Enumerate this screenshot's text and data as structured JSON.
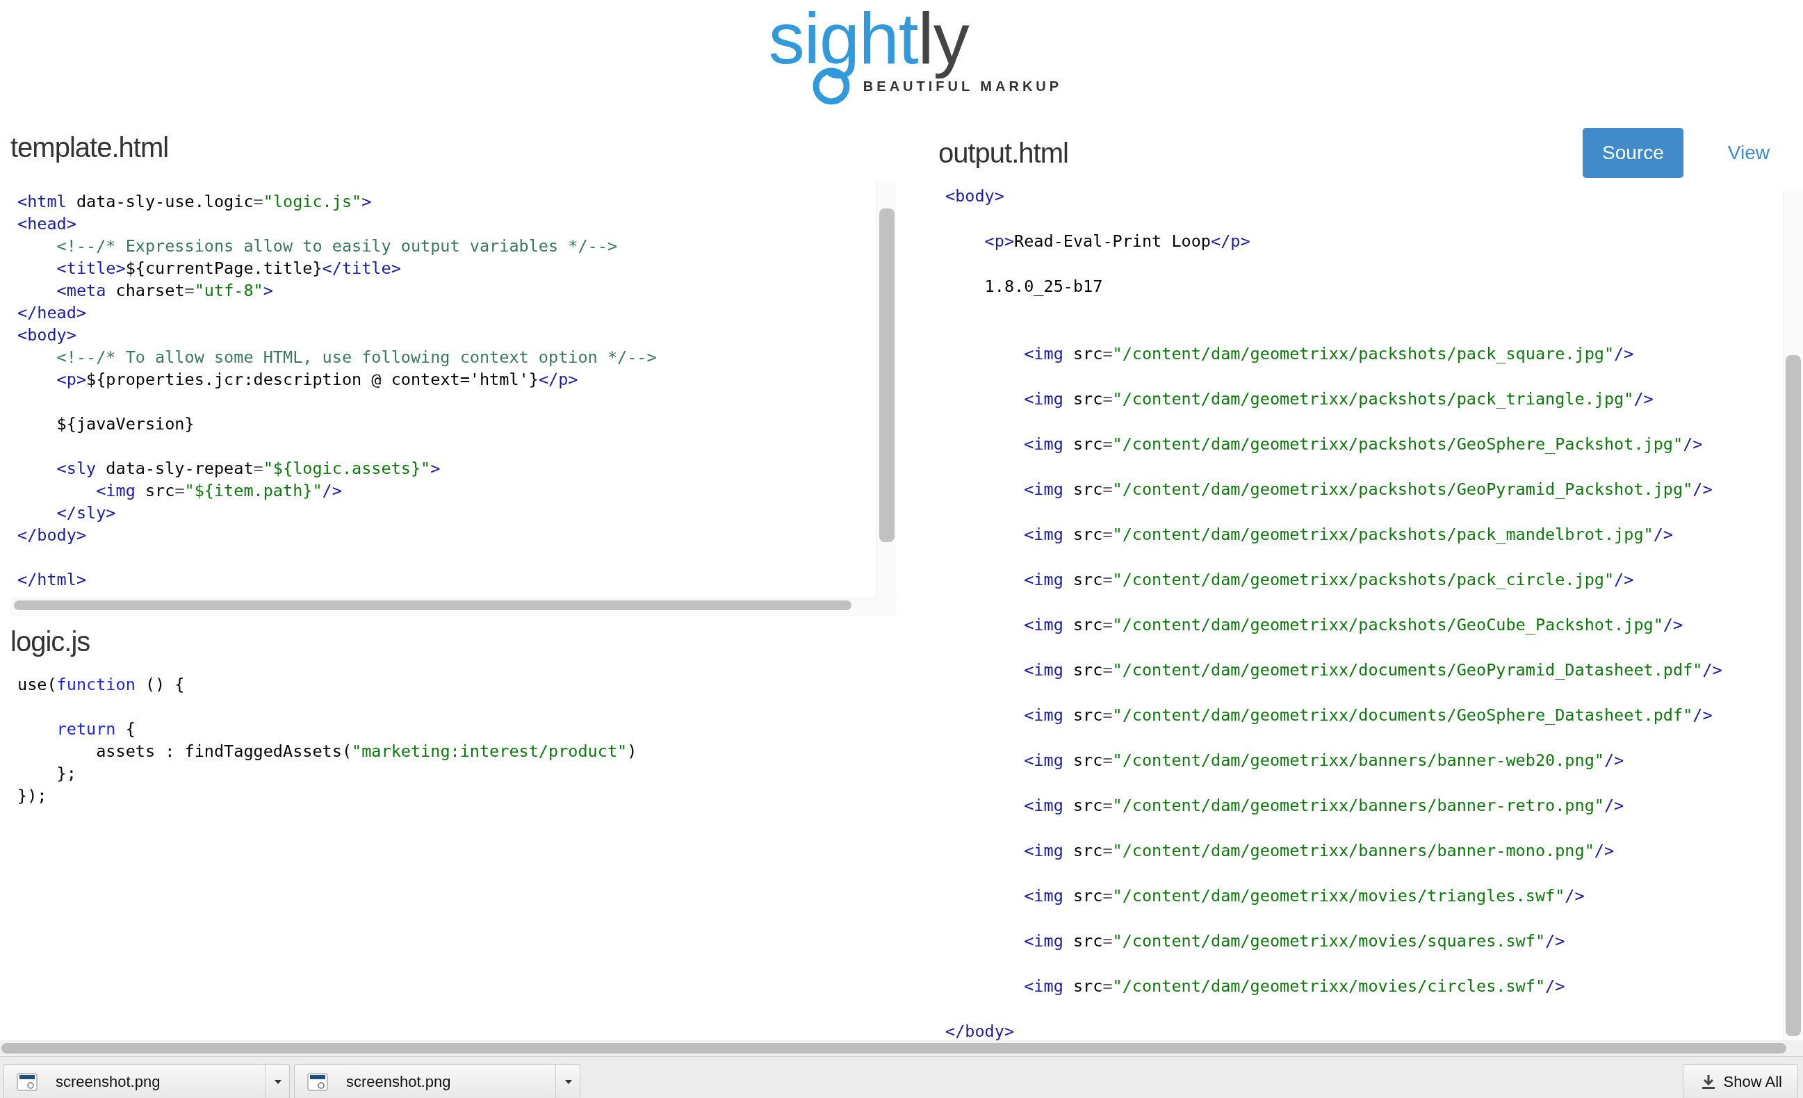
{
  "logo": {
    "wordmark": [
      "sight",
      "ly"
    ],
    "tagline": "BEAUTIFUL MARKUP"
  },
  "template_editor": {
    "title": "template.html",
    "lines": [
      {
        "kind": "code",
        "tokens": [
          {
            "kind": "tag",
            "text": "<html"
          },
          {
            "kind": "plain",
            "text": " data-sly-use.logic"
          },
          {
            "kind": "op",
            "text": "="
          },
          {
            "kind": "string",
            "text": "\"logic.js\""
          },
          {
            "kind": "tag",
            "text": ">"
          }
        ]
      },
      {
        "kind": "code",
        "tokens": [
          {
            "kind": "tag",
            "text": "<head>"
          }
        ]
      },
      {
        "kind": "code",
        "tokens": [
          {
            "kind": "comment",
            "text": "    <!--/* Expressions allow to easily output variables */-->"
          }
        ]
      },
      {
        "kind": "code",
        "tokens": [
          {
            "kind": "tag",
            "text": "    <title>"
          },
          {
            "kind": "plain",
            "text": "${currentPage.title}"
          },
          {
            "kind": "tag",
            "text": "</title>"
          }
        ]
      },
      {
        "kind": "code",
        "tokens": [
          {
            "kind": "tag",
            "text": "    <meta"
          },
          {
            "kind": "plain",
            "text": " charset"
          },
          {
            "kind": "op",
            "text": "="
          },
          {
            "kind": "string",
            "text": "\"utf-8\""
          },
          {
            "kind": "tag",
            "text": ">"
          }
        ]
      },
      {
        "kind": "code",
        "tokens": [
          {
            "kind": "tag",
            "text": "</head>"
          }
        ]
      },
      {
        "kind": "code",
        "tokens": [
          {
            "kind": "tag",
            "text": "<body>"
          }
        ]
      },
      {
        "kind": "code",
        "tokens": [
          {
            "kind": "comment",
            "text": "    <!--/* To allow some HTML, use following context option */-->"
          }
        ]
      },
      {
        "kind": "code",
        "tokens": [
          {
            "kind": "tag",
            "text": "    <p>"
          },
          {
            "kind": "plain",
            "text": "${properties.jcr:description @ context='html'}"
          },
          {
            "kind": "tag",
            "text": "</p>"
          }
        ]
      },
      {
        "kind": "blank"
      },
      {
        "kind": "code",
        "tokens": [
          {
            "kind": "plain",
            "text": "    ${javaVersion}"
          }
        ]
      },
      {
        "kind": "blank"
      },
      {
        "kind": "code",
        "tokens": [
          {
            "kind": "tag",
            "text": "    <sly"
          },
          {
            "kind": "plain",
            "text": " data-sly-repeat"
          },
          {
            "kind": "op",
            "text": "="
          },
          {
            "kind": "string",
            "text": "\"${logic.assets}\""
          },
          {
            "kind": "tag",
            "text": ">"
          }
        ]
      },
      {
        "kind": "code",
        "tokens": [
          {
            "kind": "tag",
            "text": "        <img"
          },
          {
            "kind": "plain",
            "text": " src"
          },
          {
            "kind": "op",
            "text": "="
          },
          {
            "kind": "string",
            "text": "\"${item.path}\""
          },
          {
            "kind": "tag",
            "text": "/>"
          }
        ]
      },
      {
        "kind": "code",
        "tokens": [
          {
            "kind": "tag",
            "text": "    </sly>"
          }
        ]
      },
      {
        "kind": "code",
        "tokens": [
          {
            "kind": "tag",
            "text": "</body>"
          }
        ]
      },
      {
        "kind": "blank"
      },
      {
        "kind": "code",
        "tokens": [
          {
            "kind": "tag",
            "text": "</html>"
          }
        ]
      }
    ]
  },
  "logic_editor": {
    "title": "logic.js",
    "lines": [
      {
        "kind": "code",
        "tokens": [
          {
            "kind": "plain",
            "text": "use("
          },
          {
            "kind": "keyword",
            "text": "function"
          },
          {
            "kind": "plain",
            "text": " () {"
          }
        ]
      },
      {
        "kind": "blank"
      },
      {
        "kind": "code",
        "tokens": [
          {
            "kind": "keyword",
            "text": "    return"
          },
          {
            "kind": "plain",
            "text": " {"
          }
        ]
      },
      {
        "kind": "code",
        "tokens": [
          {
            "kind": "plain",
            "text": "        assets : findTaggedAssets("
          },
          {
            "kind": "string",
            "text": "\"marketing:interest/product\""
          },
          {
            "kind": "plain",
            "text": ")"
          }
        ]
      },
      {
        "kind": "code",
        "tokens": [
          {
            "kind": "plain",
            "text": "    };"
          }
        ]
      },
      {
        "kind": "code",
        "tokens": [
          {
            "kind": "plain",
            "text": "});"
          }
        ]
      }
    ]
  },
  "output_panel": {
    "title": "output.html",
    "modes": [
      {
        "label": "Source",
        "selected": true
      },
      {
        "label": "View",
        "selected": false
      }
    ],
    "lines": [
      {
        "kind": "code",
        "tokens": [
          {
            "kind": "tag",
            "text": "<body>"
          }
        ]
      },
      {
        "kind": "code",
        "tokens": [
          {
            "kind": "tag",
            "text": "    <p>"
          },
          {
            "kind": "plain",
            "text": "Read-Eval-Print Loop"
          },
          {
            "kind": "tag",
            "text": "</p>"
          }
        ]
      },
      {
        "kind": "code",
        "tokens": [
          {
            "kind": "plain",
            "text": "    1.8.0_25-b17"
          }
        ]
      },
      {
        "kind": "blank"
      },
      {
        "kind": "code",
        "tokens": [
          {
            "kind": "tag",
            "text": "        <img"
          },
          {
            "kind": "plain",
            "text": " src"
          },
          {
            "kind": "op",
            "text": "="
          },
          {
            "kind": "string",
            "text": "\"/content/dam/geometrixx/packshots/pack_square.jpg\""
          },
          {
            "kind": "tag",
            "text": "/>"
          }
        ]
      },
      {
        "kind": "code",
        "tokens": [
          {
            "kind": "tag",
            "text": "        <img"
          },
          {
            "kind": "plain",
            "text": " src"
          },
          {
            "kind": "op",
            "text": "="
          },
          {
            "kind": "string",
            "text": "\"/content/dam/geometrixx/packshots/pack_triangle.jpg\""
          },
          {
            "kind": "tag",
            "text": "/>"
          }
        ]
      },
      {
        "kind": "code",
        "tokens": [
          {
            "kind": "tag",
            "text": "        <img"
          },
          {
            "kind": "plain",
            "text": " src"
          },
          {
            "kind": "op",
            "text": "="
          },
          {
            "kind": "string",
            "text": "\"/content/dam/geometrixx/packshots/GeoSphere_Packshot.jpg\""
          },
          {
            "kind": "tag",
            "text": "/>"
          }
        ]
      },
      {
        "kind": "code",
        "tokens": [
          {
            "kind": "tag",
            "text": "        <img"
          },
          {
            "kind": "plain",
            "text": " src"
          },
          {
            "kind": "op",
            "text": "="
          },
          {
            "kind": "string",
            "text": "\"/content/dam/geometrixx/packshots/GeoPyramid_Packshot.jpg\""
          },
          {
            "kind": "tag",
            "text": "/>"
          }
        ]
      },
      {
        "kind": "code",
        "tokens": [
          {
            "kind": "tag",
            "text": "        <img"
          },
          {
            "kind": "plain",
            "text": " src"
          },
          {
            "kind": "op",
            "text": "="
          },
          {
            "kind": "string",
            "text": "\"/content/dam/geometrixx/packshots/pack_mandelbrot.jpg\""
          },
          {
            "kind": "tag",
            "text": "/>"
          }
        ]
      },
      {
        "kind": "code",
        "tokens": [
          {
            "kind": "tag",
            "text": "        <img"
          },
          {
            "kind": "plain",
            "text": " src"
          },
          {
            "kind": "op",
            "text": "="
          },
          {
            "kind": "string",
            "text": "\"/content/dam/geometrixx/packshots/pack_circle.jpg\""
          },
          {
            "kind": "tag",
            "text": "/>"
          }
        ]
      },
      {
        "kind": "code",
        "tokens": [
          {
            "kind": "tag",
            "text": "        <img"
          },
          {
            "kind": "plain",
            "text": " src"
          },
          {
            "kind": "op",
            "text": "="
          },
          {
            "kind": "string",
            "text": "\"/content/dam/geometrixx/packshots/GeoCube_Packshot.jpg\""
          },
          {
            "kind": "tag",
            "text": "/>"
          }
        ]
      },
      {
        "kind": "code",
        "tokens": [
          {
            "kind": "tag",
            "text": "        <img"
          },
          {
            "kind": "plain",
            "text": " src"
          },
          {
            "kind": "op",
            "text": "="
          },
          {
            "kind": "string",
            "text": "\"/content/dam/geometrixx/documents/GeoPyramid_Datasheet.pdf\""
          },
          {
            "kind": "tag",
            "text": "/>"
          }
        ]
      },
      {
        "kind": "code",
        "tokens": [
          {
            "kind": "tag",
            "text": "        <img"
          },
          {
            "kind": "plain",
            "text": " src"
          },
          {
            "kind": "op",
            "text": "="
          },
          {
            "kind": "string",
            "text": "\"/content/dam/geometrixx/documents/GeoSphere_Datasheet.pdf\""
          },
          {
            "kind": "tag",
            "text": "/>"
          }
        ]
      },
      {
        "kind": "code",
        "tokens": [
          {
            "kind": "tag",
            "text": "        <img"
          },
          {
            "kind": "plain",
            "text": " src"
          },
          {
            "kind": "op",
            "text": "="
          },
          {
            "kind": "string",
            "text": "\"/content/dam/geometrixx/banners/banner-web20.png\""
          },
          {
            "kind": "tag",
            "text": "/>"
          }
        ]
      },
      {
        "kind": "code",
        "tokens": [
          {
            "kind": "tag",
            "text": "        <img"
          },
          {
            "kind": "plain",
            "text": " src"
          },
          {
            "kind": "op",
            "text": "="
          },
          {
            "kind": "string",
            "text": "\"/content/dam/geometrixx/banners/banner-retro.png\""
          },
          {
            "kind": "tag",
            "text": "/>"
          }
        ]
      },
      {
        "kind": "code",
        "tokens": [
          {
            "kind": "tag",
            "text": "        <img"
          },
          {
            "kind": "plain",
            "text": " src"
          },
          {
            "kind": "op",
            "text": "="
          },
          {
            "kind": "string",
            "text": "\"/content/dam/geometrixx/banners/banner-mono.png\""
          },
          {
            "kind": "tag",
            "text": "/>"
          }
        ]
      },
      {
        "kind": "code",
        "tokens": [
          {
            "kind": "tag",
            "text": "        <img"
          },
          {
            "kind": "plain",
            "text": " src"
          },
          {
            "kind": "op",
            "text": "="
          },
          {
            "kind": "string",
            "text": "\"/content/dam/geometrixx/movies/triangles.swf\""
          },
          {
            "kind": "tag",
            "text": "/>"
          }
        ]
      },
      {
        "kind": "code",
        "tokens": [
          {
            "kind": "tag",
            "text": "        <img"
          },
          {
            "kind": "plain",
            "text": " src"
          },
          {
            "kind": "op",
            "text": "="
          },
          {
            "kind": "string",
            "text": "\"/content/dam/geometrixx/movies/squares.swf\""
          },
          {
            "kind": "tag",
            "text": "/>"
          }
        ]
      },
      {
        "kind": "code",
        "tokens": [
          {
            "kind": "tag",
            "text": "        <img"
          },
          {
            "kind": "plain",
            "text": " src"
          },
          {
            "kind": "op",
            "text": "="
          },
          {
            "kind": "string",
            "text": "\"/content/dam/geometrixx/movies/circles.swf\""
          },
          {
            "kind": "tag",
            "text": "/>"
          }
        ]
      },
      {
        "kind": "code",
        "tokens": [
          {
            "kind": "tag",
            "text": "</body>"
          }
        ]
      }
    ]
  },
  "downloads_bar": {
    "items": [
      "screenshot.png",
      "screenshot.png"
    ],
    "show_all": "Show All"
  }
}
